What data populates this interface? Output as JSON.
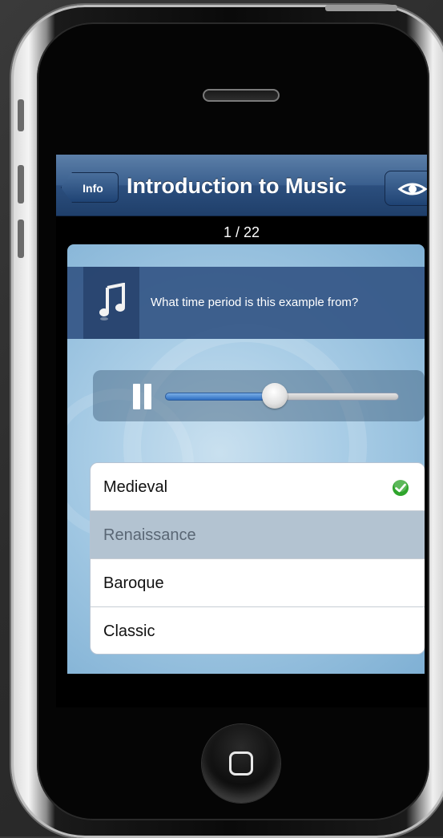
{
  "navbar": {
    "back_label": "Info",
    "title": "Introduction to Music",
    "right_icon": "eye-icon"
  },
  "counter": {
    "text": "1 / 22"
  },
  "question": {
    "icon": "music-note-icon",
    "text": "What time period is this example from?"
  },
  "player": {
    "state": "playing",
    "control_icon": "pause-icon",
    "progress": 0.47
  },
  "answers": [
    {
      "label": "Medieval",
      "state": "correct",
      "icon": "checkmark-icon"
    },
    {
      "label": "Renaissance",
      "state": "selected"
    },
    {
      "label": "Baroque",
      "state": "normal"
    },
    {
      "label": "Classic",
      "state": "normal"
    }
  ],
  "colors": {
    "navbar": "#2c4f7e",
    "question_band": "#345686",
    "content_bg": "#a9cde6",
    "selected_row": "#b3c3d1",
    "check_green": "#2fa52c",
    "slider_fill": "#2f6fc2"
  }
}
